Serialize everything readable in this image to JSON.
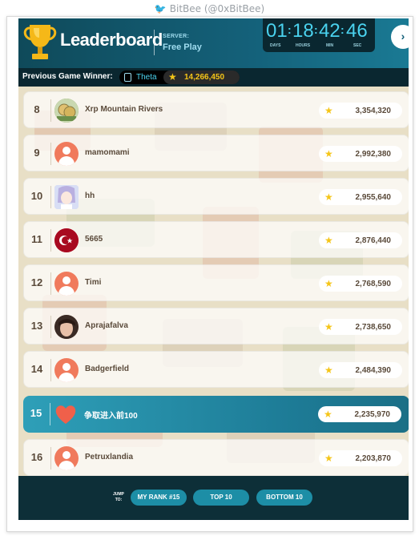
{
  "attribution": {
    "text": "BitBee (@0xBitBee)",
    "icon": "bird-icon"
  },
  "header": {
    "title": "Leaderboard",
    "server_label": "SERVER:",
    "server_value": "Free Play",
    "trophy_icon": "trophy-icon",
    "collapse_icon": "chevron-right-icon"
  },
  "timer": {
    "days": "01",
    "hours": "18",
    "min": "42",
    "sec": "46",
    "labels": {
      "days": "DAYS",
      "hours": "HOURS",
      "min": "MIN",
      "sec": "SEC"
    }
  },
  "previous_winner": {
    "label": "Previous Game Winner:",
    "name": "Theta",
    "score": "14,266,450",
    "wallet_icon": "wallet-icon",
    "star_icon": "star-icon"
  },
  "rows": [
    {
      "rank": "8",
      "name": "Xrp Mountain Rivers",
      "score": "3,354,320",
      "avatar": "coins",
      "highlight": false
    },
    {
      "rank": "9",
      "name": "mamomami",
      "score": "2,992,380",
      "avatar": "default",
      "highlight": false
    },
    {
      "rank": "10",
      "name": "hh",
      "score": "2,955,640",
      "avatar": "anime",
      "highlight": false
    },
    {
      "rank": "11",
      "name": "5665",
      "score": "2,876,440",
      "avatar": "flag",
      "highlight": false
    },
    {
      "rank": "12",
      "name": "Timi",
      "score": "2,768,590",
      "avatar": "default",
      "highlight": false
    },
    {
      "rank": "13",
      "name": "Aprajafalva",
      "score": "2,738,650",
      "avatar": "photo",
      "highlight": false
    },
    {
      "rank": "14",
      "name": "Badgerfield",
      "score": "2,484,390",
      "avatar": "default",
      "highlight": false
    },
    {
      "rank": "15",
      "name": "争取进入前100",
      "score": "2,235,970",
      "avatar": "heart",
      "highlight": true
    },
    {
      "rank": "16",
      "name": "Petruxlandia",
      "score": "2,203,870",
      "avatar": "default",
      "highlight": false
    }
  ],
  "footer": {
    "jump_line1": "JUMP",
    "jump_line2": "TO:",
    "my_rank": "MY RANK #15",
    "top10": "TOP 10",
    "bottom10": "BOTTOM 10"
  },
  "colors": {
    "header_bg": "#14617a",
    "accent": "#4ad2ee",
    "highlight_row": "#1d7b96",
    "score_star": "#f5c518",
    "default_avatar": "#f07a5c"
  }
}
